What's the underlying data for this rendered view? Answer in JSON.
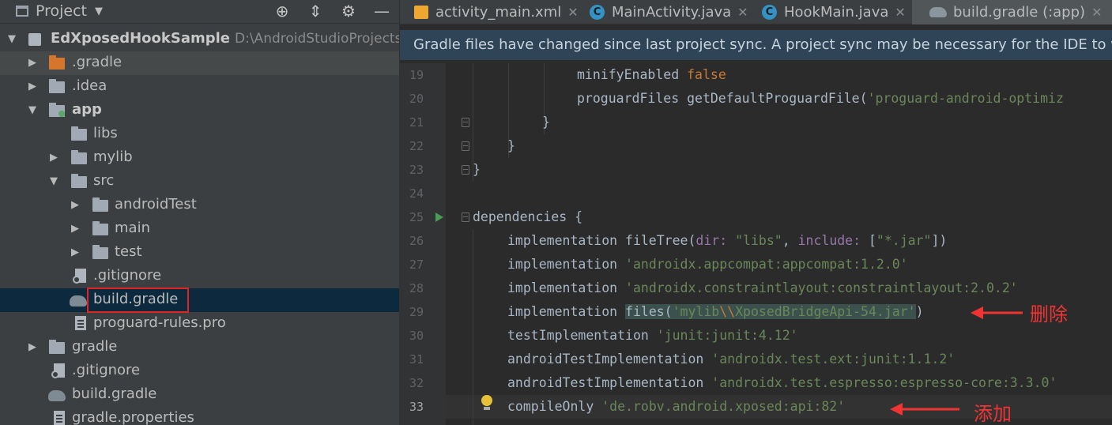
{
  "project_panel": {
    "title": "Project",
    "tree": [
      {
        "label": "EdXposedHookSample",
        "path_hint": "D:\\AndroidStudioProjects\\",
        "kind": "module",
        "expanded": true,
        "bold": true
      },
      {
        "label": ".gradle",
        "kind": "folder-orange",
        "expanded": false
      },
      {
        "label": ".idea",
        "kind": "folder",
        "expanded": false
      },
      {
        "label": "app",
        "kind": "folder-module",
        "expanded": true,
        "bold": true
      },
      {
        "label": "libs",
        "kind": "folder"
      },
      {
        "label": "mylib",
        "kind": "folder",
        "expanded": false
      },
      {
        "label": "src",
        "kind": "folder",
        "expanded": true
      },
      {
        "label": "androidTest",
        "kind": "folder",
        "expanded": false
      },
      {
        "label": "main",
        "kind": "folder",
        "expanded": false
      },
      {
        "label": "test",
        "kind": "folder",
        "expanded": false
      },
      {
        "label": ".gitignore",
        "kind": "gitignore"
      },
      {
        "label": "build.gradle",
        "kind": "gradle",
        "selected": true
      },
      {
        "label": "proguard-rules.pro",
        "kind": "file"
      },
      {
        "label": "gradle",
        "kind": "folder",
        "expanded": false
      },
      {
        "label": ".gitignore",
        "kind": "gitignore"
      },
      {
        "label": "build.gradle",
        "kind": "gradle"
      },
      {
        "label": "gradle.properties",
        "kind": "gradle-file"
      }
    ]
  },
  "tabs": [
    {
      "label": "activity_main.xml",
      "icon": "xml-icon"
    },
    {
      "label": "MainActivity.java",
      "icon": "class-icon"
    },
    {
      "label": "HookMain.java",
      "icon": "class-icon"
    },
    {
      "label": "build.gradle (:app)",
      "icon": "gradle-icon",
      "active": true
    }
  ],
  "banner": "Gradle files have changed since last project sync. A project sync may be necessary for the IDE to work p",
  "editor": {
    "line_numbers": [
      "19",
      "20",
      "21",
      "22",
      "23",
      "24",
      "25",
      "26",
      "27",
      "28",
      "29",
      "30",
      "31",
      "32",
      "33"
    ],
    "code": {
      "l19_a": "minifyEnabled ",
      "l19_b": "false",
      "l20_a": "proguardFiles getDefaultProguardFile(",
      "l20_b": "'proguard-android-optimiz",
      "l21": "}",
      "l22": "}",
      "l23": "}",
      "l25_a": "dependencies {",
      "l26_a": "implementation fileTree(",
      "l26_b": "dir: ",
      "l26_c": "\"libs\"",
      "l26_d": ", ",
      "l26_e": "include: ",
      "l26_f": "[",
      "l26_g": "\"*.jar\"",
      "l26_h": "])",
      "l27_a": "implementation ",
      "l27_b": "'androidx.appcompat:appcompat:1.2.0'",
      "l28_a": "implementation ",
      "l28_b": "'androidx.constraintlayout:constraintlayout:2.0.2'",
      "l29_a": "implementation ",
      "l29_b": "files(",
      "l29_c": "'mylib",
      "l29_d": "\\\\",
      "l29_e": "XposedBridgeApi-54.jar'",
      "l29_f": ")",
      "l30_a": "testImplementation ",
      "l30_b": "'junit:junit:4.12'",
      "l31_a": "androidTestImplementation ",
      "l31_b": "'androidx.test.ext:junit:1.1.2'",
      "l32_a": "androidTestImplementation ",
      "l32_b": "'androidx.test.espresso:espresso-core:3.3.0'",
      "l33_a": "compileOnly ",
      "l33_b": "'de.robv.android.xposed:api:82'"
    }
  },
  "annotations": {
    "delete_label": "删除",
    "add_label": "添加"
  }
}
